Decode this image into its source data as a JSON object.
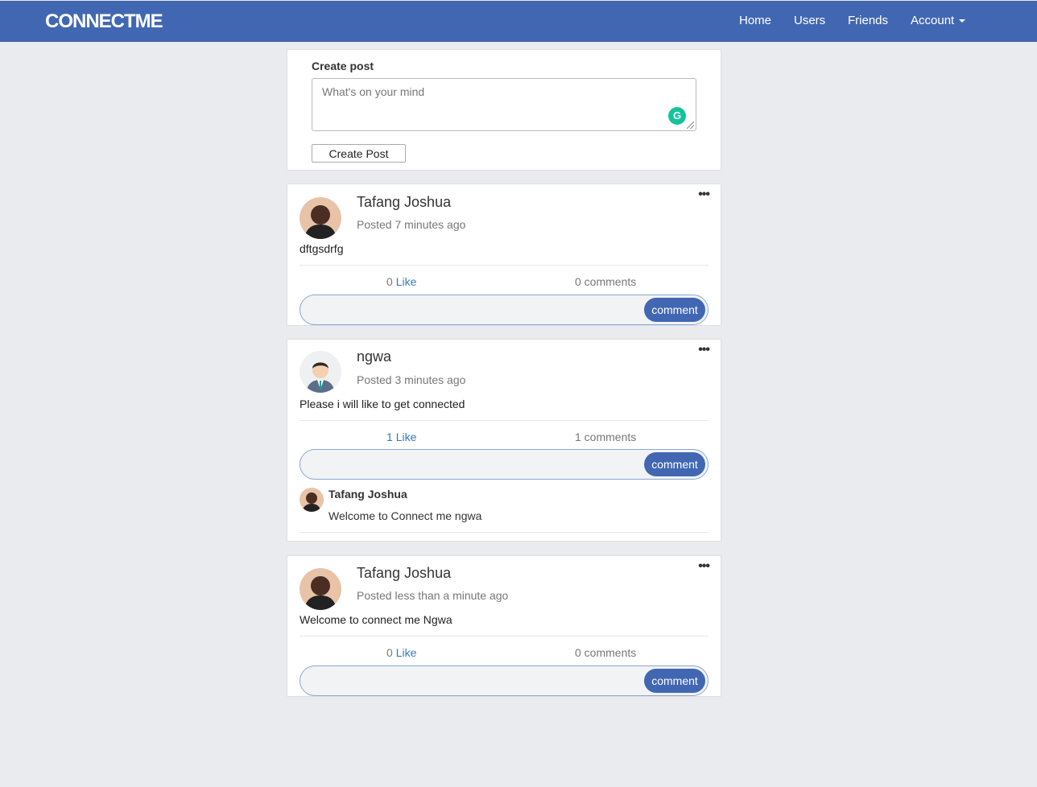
{
  "navbar": {
    "brand": "CONNECTME",
    "links": [
      "Home",
      "Users",
      "Friends"
    ],
    "account": "Account"
  },
  "create_post": {
    "title": "Create post",
    "placeholder": "What's on your mind",
    "button": "Create Post"
  },
  "posts": [
    {
      "author": "Tafang Joshua",
      "time": "Posted 7 minutes ago",
      "body": "dftgsdrfg",
      "like_count": "0",
      "like_label": "Like",
      "comments": "0 comments",
      "comment_button": "comment"
    },
    {
      "author": "ngwa",
      "time": "Posted 3 minutes ago",
      "body": "Please i will like to get connected",
      "like_count": "1",
      "like_label": "Like",
      "comments": "1 comments",
      "comment_button": "comment",
      "comment_list": [
        {
          "author": "Tafang Joshua",
          "text": "Welcome to Connect me ngwa"
        }
      ]
    },
    {
      "author": "Tafang Joshua",
      "time": "Posted less than a minute ago",
      "body": "Welcome to connect me Ngwa",
      "like_count": "0",
      "like_label": "Like",
      "comments": "0 comments",
      "comment_button": "comment"
    }
  ],
  "colors": {
    "brand": "#4267b2",
    "background": "#e9ebee",
    "link": "#337ab7"
  },
  "icons": [
    "more-options-icon",
    "grammarly-icon",
    "caret-down-icon"
  ]
}
